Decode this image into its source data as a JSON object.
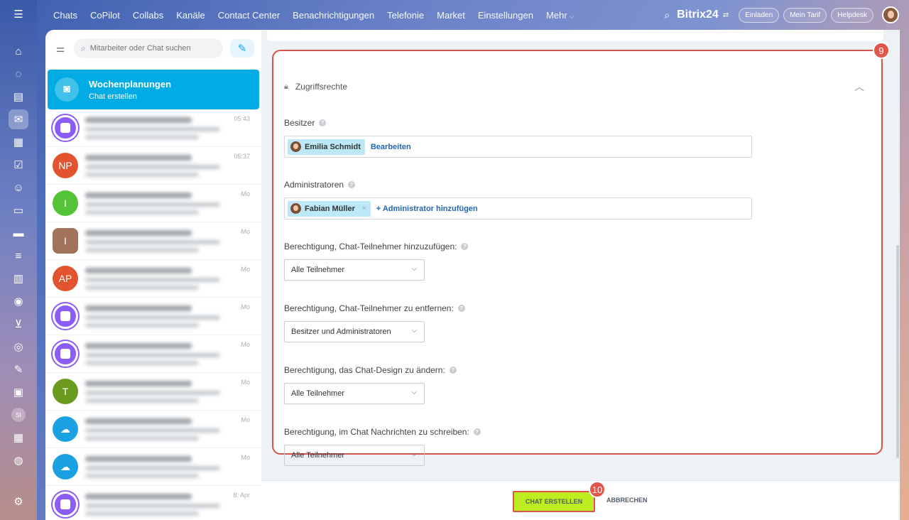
{
  "topnav": {
    "items": [
      "Chats",
      "CoPilot",
      "Collabs",
      "Kanäle",
      "Contact Center",
      "Benachrichtigungen",
      "Telefonie",
      "Market",
      "Einstellungen",
      "Mehr"
    ],
    "brand": "Bitrix24",
    "invite": "Einladen",
    "tariff": "Mein Tarif",
    "helpdesk": "Helpdesk"
  },
  "rail": {
    "user_initials": "SI"
  },
  "search": {
    "placeholder": "Mitarbeiter oder Chat suchen"
  },
  "active_chat": {
    "title": "Wochenplanungen",
    "subtitle": "Chat erstellen"
  },
  "chat_items": [
    {
      "time": "05:43",
      "avatar": "",
      "color": "#8b5cf6"
    },
    {
      "time": "05:37",
      "avatar": "NP",
      "color": "#e2542e"
    },
    {
      "time": "Mo",
      "avatar": "I",
      "color": "#55c337"
    },
    {
      "time": "Mo",
      "avatar": "I",
      "color": "#a0735a"
    },
    {
      "time": "Mo",
      "avatar": "AP",
      "color": "#e2542e"
    },
    {
      "time": "Mo",
      "avatar": "",
      "color": "#8b5cf6"
    },
    {
      "time": "Mo",
      "avatar": "",
      "color": "#8b5cf6"
    },
    {
      "time": "Mo",
      "avatar": "T",
      "color": "#6a9b1e"
    },
    {
      "time": "Mo",
      "avatar": "",
      "color": "#1ba0e2"
    },
    {
      "time": "Mo",
      "avatar": "",
      "color": "#1ba0e2"
    },
    {
      "time": "8. Apr",
      "avatar": "",
      "color": "#8b5cf6"
    }
  ],
  "permissions": {
    "title": "Zugriffsrechte",
    "owner_label": "Besitzer",
    "owner_name": "Emilia Schmidt",
    "owner_edit": "Bearbeiten",
    "admins_label": "Administratoren",
    "admin_name": "Fabian Müller",
    "admin_add": "+ Administrator hinzufügen",
    "add_members_label": "Berechtigung, Chat-Teilnehmer hinzuzufügen:",
    "add_members_value": "Alle Teilnehmer",
    "remove_members_label": "Berechtigung, Chat-Teilnehmer zu entfernen:",
    "remove_members_value": "Besitzer und Administratoren",
    "design_label": "Berechtigung, das Chat-Design zu ändern:",
    "design_value": "Alle Teilnehmer",
    "write_label": "Berechtigung, im Chat Nachrichten zu schreiben:",
    "write_value": "Alle Teilnehmer"
  },
  "footer": {
    "create": "CHAT ERSTELLEN",
    "cancel": "ABBRECHEN"
  },
  "badges": {
    "step9": "9",
    "step10": "10"
  },
  "colors": {
    "accent": "#00ace3",
    "create_button": "#bbed21",
    "highlight": "#d9534f"
  }
}
